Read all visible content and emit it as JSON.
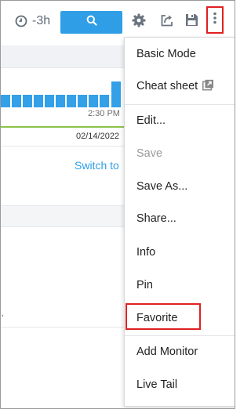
{
  "toolbar": {
    "time_range": "-3h",
    "icons": [
      "clock-icon",
      "search-icon",
      "gear-icon",
      "share-icon",
      "save-icon",
      "more-vertical-icon"
    ]
  },
  "chart_area": {
    "axis_time": "2:30 PM",
    "axis_date": "02/14/2022",
    "switch_link": "Switch to"
  },
  "menu": {
    "basic_mode": "Basic Mode",
    "cheat_sheet": "Cheat sheet",
    "edit": "Edit...",
    "save": "Save",
    "save_as": "Save As...",
    "share": "Share...",
    "info": "Info",
    "pin": "Pin",
    "favorite": "Favorite",
    "add_monitor": "Add Monitor",
    "live_tail": "Live Tail"
  },
  "colors": {
    "accent": "#2f9ee6",
    "highlight": "#e02020",
    "axis_green": "#8bc34a"
  }
}
